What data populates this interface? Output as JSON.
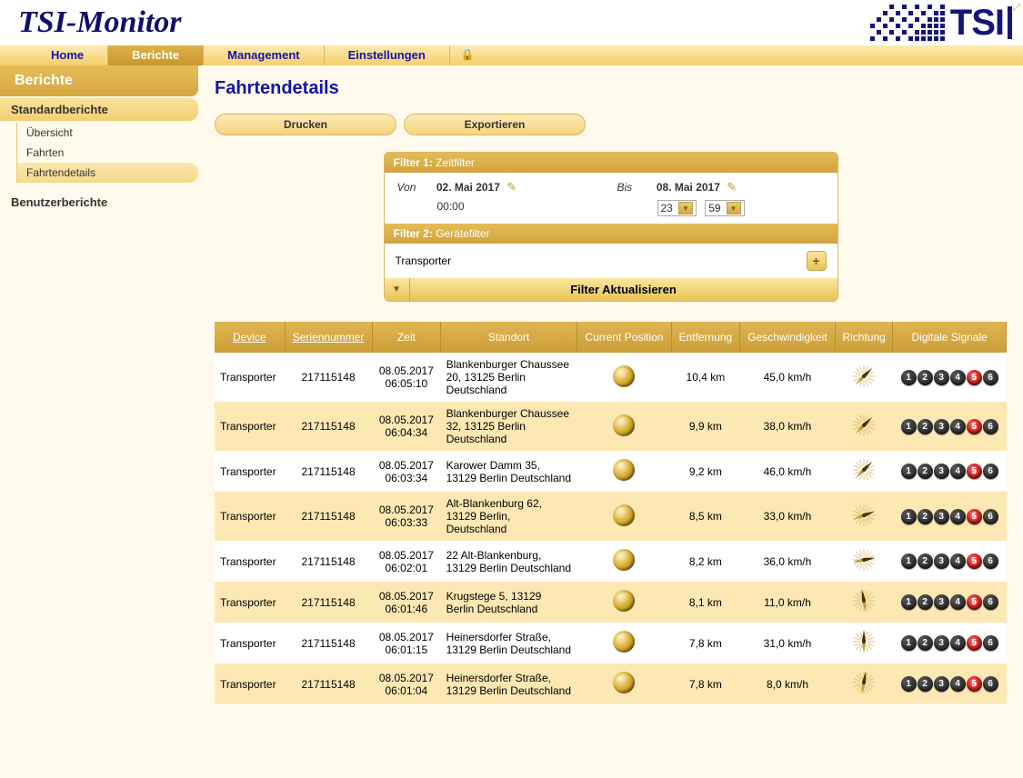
{
  "app_title": "TSI-Monitor",
  "brand_short": "TSI",
  "nav": {
    "items": [
      "Home",
      "Berichte",
      "Management",
      "Einstellungen"
    ],
    "active_index": 1
  },
  "sidebar": {
    "title": "Berichte",
    "groups": [
      {
        "label": "Standardberichte",
        "items": [
          "Übersicht",
          "Fahrten",
          "Fahrtendetails"
        ],
        "selected_index": 2
      },
      {
        "label": "Benutzerberichte",
        "items": []
      }
    ]
  },
  "page": {
    "title": "Fahrtendetails",
    "buttons": {
      "print": "Drucken",
      "export": "Exportieren"
    }
  },
  "filters": {
    "filter1": {
      "head_label": "Filter 1:",
      "head_name": "Zeitfilter",
      "from_label": "Von",
      "from_date": "02. Mai 2017",
      "from_time": "00:00",
      "to_label": "Bis",
      "to_date": "08. Mai 2017",
      "to_hour": "23",
      "to_min": "59"
    },
    "filter2": {
      "head_label": "Filter 2:",
      "head_name": "Gerätefilter",
      "device": "Transporter"
    },
    "update_btn": "Filter Aktualisieren"
  },
  "table": {
    "headers": [
      "Device",
      "Seriennummer",
      "Zeit",
      "Standort",
      "Current Position",
      "Entfernung",
      "Geschwindigkeit",
      "Richtung",
      "Digitale Signale"
    ],
    "rows": [
      {
        "device": "Transporter",
        "serial": "217115148",
        "date": "08.05.2017",
        "time": "06:05:10",
        "location": "Blankenburger Chaussee 20, 13125 Berlin Deutschland",
        "distance": "10,4 km",
        "speed": "45,0 km/h",
        "heading_deg": 45,
        "signals": [
          false,
          false,
          false,
          false,
          true,
          false
        ]
      },
      {
        "device": "Transporter",
        "serial": "217115148",
        "date": "08.05.2017",
        "time": "06:04:34",
        "location": "Blankenburger Chaussee 32, 13125 Berlin Deutschland",
        "distance": "9,9 km",
        "speed": "38,0 km/h",
        "heading_deg": 45,
        "signals": [
          false,
          false,
          false,
          false,
          true,
          false
        ]
      },
      {
        "device": "Transporter",
        "serial": "217115148",
        "date": "08.05.2017",
        "time": "06:03:34",
        "location": "Karower Damm 35, 13129 Berlin Deutschland",
        "distance": "9,2 km",
        "speed": "46,0 km/h",
        "heading_deg": 45,
        "signals": [
          false,
          false,
          false,
          false,
          true,
          false
        ]
      },
      {
        "device": "Transporter",
        "serial": "217115148",
        "date": "08.05.2017",
        "time": "06:03:33",
        "location": "Alt-Blankenburg 62, 13129 Berlin, Deutschland",
        "distance": "8,5 km",
        "speed": "33,0 km/h",
        "heading_deg": 70,
        "signals": [
          false,
          false,
          false,
          false,
          true,
          false
        ]
      },
      {
        "device": "Transporter",
        "serial": "217115148",
        "date": "08.05.2017",
        "time": "06:02:01",
        "location": "22 Alt-Blankenburg, 13129 Berlin Deutschland",
        "distance": "8,2 km",
        "speed": "36,0 km/h",
        "heading_deg": 80,
        "signals": [
          false,
          false,
          false,
          false,
          true,
          false
        ]
      },
      {
        "device": "Transporter",
        "serial": "217115148",
        "date": "08.05.2017",
        "time": "06:01:46",
        "location": "Krugstege 5, 13129 Berlin Deutschland",
        "distance": "8,1 km",
        "speed": "11,0 km/h",
        "heading_deg": 350,
        "signals": [
          false,
          false,
          false,
          false,
          true,
          false
        ]
      },
      {
        "device": "Transporter",
        "serial": "217115148",
        "date": "08.05.2017",
        "time": "06:01:15",
        "location": "Heinersdorfer Straße, 13129 Berlin Deutschland",
        "distance": "7,8 km",
        "speed": "31,0 km/h",
        "heading_deg": 0,
        "signals": [
          false,
          false,
          false,
          false,
          true,
          false
        ]
      },
      {
        "device": "Transporter",
        "serial": "217115148",
        "date": "08.05.2017",
        "time": "06:01:04",
        "location": "Heinersdorfer Straße, 13129 Berlin Deutschland",
        "distance": "7,8 km",
        "speed": "8,0 km/h",
        "heading_deg": 10,
        "signals": [
          false,
          false,
          false,
          false,
          true,
          false
        ]
      }
    ]
  }
}
